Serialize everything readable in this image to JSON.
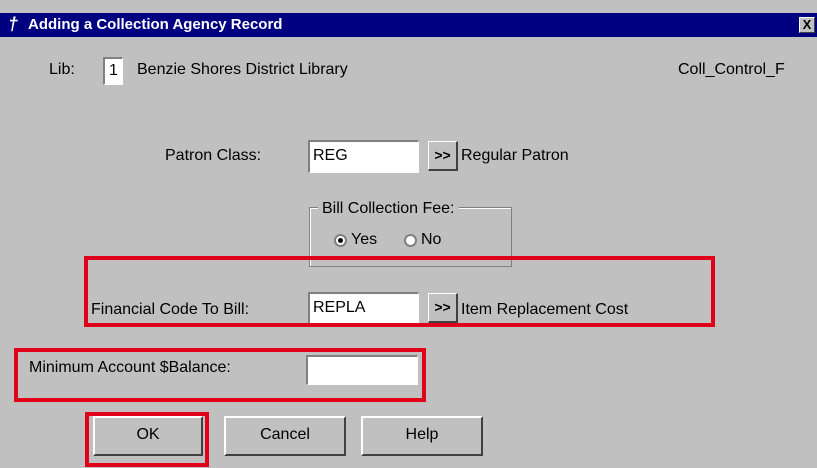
{
  "window": {
    "title": "Adding a Collection Agency  Record",
    "close_label": "X",
    "title_icon": "dagger-icon"
  },
  "header": {
    "lib_label": "Lib:",
    "lib_value": "1",
    "library_name": "Benzie Shores District Library",
    "form_id": "Coll_Control_F"
  },
  "patron_class": {
    "label": "Patron Class:",
    "value": "REG",
    "lookup_label": ">>",
    "description": "Regular Patron"
  },
  "bill_fee": {
    "legend": "Bill Collection Fee:",
    "options": [
      {
        "label": "Yes",
        "selected": true
      },
      {
        "label": "No",
        "selected": false
      }
    ]
  },
  "financial_code": {
    "label": "Financial Code To Bill:",
    "value": "REPLA",
    "lookup_label": ">>",
    "description": "Item Replacement Cost"
  },
  "min_balance": {
    "label": "Minimum Account $Balance:",
    "value": ""
  },
  "buttons": {
    "ok": "OK",
    "cancel": "Cancel",
    "help": "Help"
  },
  "colors": {
    "titlebar": "#000080",
    "dialog_bg": "#c0c0c0",
    "highlight": "#e0001a"
  }
}
